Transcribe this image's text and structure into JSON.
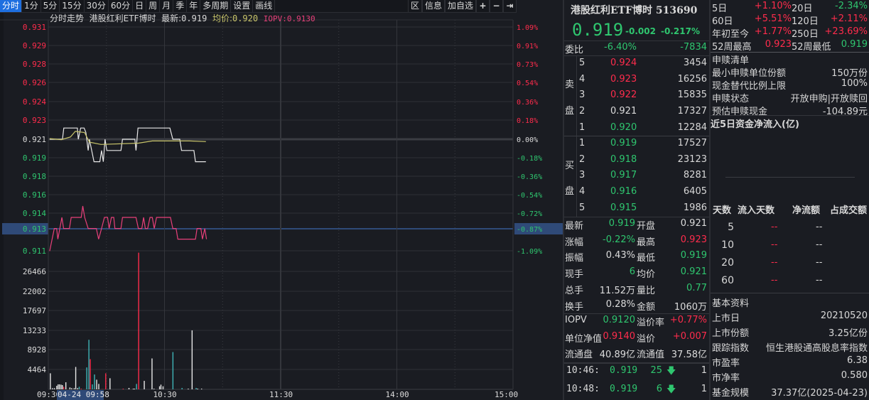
{
  "tabs": [
    "分时",
    "1分",
    "5分",
    "15分",
    "30分",
    "60分",
    "日",
    "周",
    "月",
    "季",
    "年",
    "多周期",
    "设置",
    "画线"
  ],
  "toolbar": {
    "zone": "区",
    "info": "信息",
    "add_watch": "加自选",
    "zoom_in": "+",
    "zoom_out": "−",
    "expand": "⇥"
  },
  "header": {
    "title": "分时走势",
    "name": "港股红利ETF博时",
    "latest_label": "最新:",
    "latest": "0.919",
    "avg_label": "均价:",
    "avg": "0.920",
    "iopv_label": "IOPV:",
    "iopv": "0.9130"
  },
  "chart_data": {
    "type": "line",
    "price_axis": {
      "labels": [
        "0.931",
        "0.929",
        "0.928",
        "0.926",
        "0.924",
        "0.923",
        "0.921",
        "0.919",
        "0.918",
        "0.916",
        "0.914",
        "0.913",
        "0.911"
      ],
      "range": [
        0.911,
        0.931
      ],
      "prev_close": 0.921
    },
    "pct_axis": [
      "1.09%",
      "0.91%",
      "0.73%",
      "0.54%",
      "0.36%",
      "0.18%",
      "0.00%",
      "-0.18%",
      "-0.36%",
      "-0.54%",
      "-0.72%",
      "-0.87%",
      "-1.09%"
    ],
    "highlight_price": "0.913",
    "highlight_pct": "-0.87%",
    "volume_axis": [
      "26466",
      "22002",
      "17697",
      "13233",
      "8928",
      "4464"
    ],
    "volume_max": 30800,
    "time_labels": [
      "09:30",
      "10:30",
      "11:30",
      "14:00",
      "15:00"
    ],
    "cursor_label": "04-24 09:58",
    "minutes_total": 240,
    "series": [
      {
        "name": "price",
        "color": "#e8e8e8",
        "points": [
          [
            0.7,
            0.921
          ],
          [
            7.3,
            0.921
          ],
          [
            8,
            0.922
          ],
          [
            15,
            0.922
          ],
          [
            15.5,
            0.921
          ],
          [
            16.7,
            0.922
          ],
          [
            18.5,
            0.922
          ],
          [
            19.4,
            0.9216
          ],
          [
            20.6,
            0.92
          ],
          [
            21.2,
            0.921
          ],
          [
            23.6,
            0.919
          ],
          [
            26.6,
            0.919
          ],
          [
            27.5,
            0.92
          ],
          [
            28.4,
            0.919
          ],
          [
            29.3,
            0.921
          ],
          [
            30.2,
            0.92
          ],
          [
            37.5,
            0.92
          ],
          [
            38.3,
            0.921
          ],
          [
            44.7,
            0.921
          ],
          [
            45.3,
            0.92
          ],
          [
            46.3,
            0.922
          ],
          [
            62.8,
            0.922
          ],
          [
            64.3,
            0.921
          ],
          [
            67.9,
            0.921
          ],
          [
            68.8,
            0.92
          ],
          [
            75.2,
            0.92
          ],
          [
            76,
            0.919
          ],
          [
            81.4,
            0.919
          ]
        ]
      },
      {
        "name": "average",
        "color": "#c8c46a",
        "points": [
          [
            0.7,
            0.92106
          ],
          [
            6.7,
            0.92096
          ],
          [
            11.5,
            0.92121
          ],
          [
            13.9,
            0.9217
          ],
          [
            18.7,
            0.9216
          ],
          [
            21.2,
            0.92075
          ],
          [
            27.2,
            0.92054
          ],
          [
            46.5,
            0.92065
          ],
          [
            53.7,
            0.92085
          ],
          [
            73,
            0.92085
          ],
          [
            81.4,
            0.92079
          ]
        ]
      },
      {
        "name": "iopv",
        "color": "#e8407a",
        "points": [
          [
            0.7,
            0.91104
          ],
          [
            3.1,
            0.91305
          ],
          [
            4.3,
            0.91305
          ],
          [
            4.9,
            0.9121
          ],
          [
            7,
            0.91404
          ],
          [
            7.9,
            0.91305
          ],
          [
            10.9,
            0.91305
          ],
          [
            11.8,
            0.91404
          ],
          [
            17,
            0.91404
          ],
          [
            17.8,
            0.91505
          ],
          [
            18.8,
            0.91404
          ],
          [
            20.6,
            0.91305
          ],
          [
            24.8,
            0.91305
          ],
          [
            26,
            0.9121
          ],
          [
            27.5,
            0.91305
          ],
          [
            29,
            0.91404
          ],
          [
            30.6,
            0.91404
          ],
          [
            31.4,
            0.91305
          ],
          [
            32.6,
            0.91404
          ],
          [
            33.8,
            0.91404
          ],
          [
            34.4,
            0.91305
          ],
          [
            37.5,
            0.91305
          ],
          [
            38.3,
            0.91404
          ],
          [
            45.3,
            0.91404
          ],
          [
            46.5,
            0.91305
          ],
          [
            48.3,
            0.91305
          ],
          [
            49.2,
            0.91404
          ],
          [
            50.1,
            0.91305
          ],
          [
            51.3,
            0.91305
          ],
          [
            52.5,
            0.91404
          ],
          [
            53.7,
            0.91404
          ],
          [
            54.7,
            0.91305
          ],
          [
            55.9,
            0.91404
          ],
          [
            63.1,
            0.91404
          ],
          [
            64.3,
            0.91305
          ],
          [
            66,
            0.91305
          ],
          [
            66.9,
            0.9121
          ],
          [
            76,
            0.9121
          ],
          [
            76.8,
            0.91305
          ],
          [
            78.8,
            0.91305
          ],
          [
            79.6,
            0.9121
          ],
          [
            80.8,
            0.91305
          ],
          [
            81.7,
            0.9121
          ]
        ]
      }
    ],
    "volume": [
      [
        0.8,
        3604,
        "w"
      ],
      [
        1.9,
        265,
        "w"
      ],
      [
        2.9,
        265,
        "w"
      ],
      [
        4.1,
        795,
        "w"
      ],
      [
        4.8,
        1113,
        "w"
      ],
      [
        5.5,
        1113,
        "w"
      ],
      [
        6.3,
        1060,
        "w"
      ],
      [
        7,
        954,
        "w"
      ],
      [
        7.7,
        583,
        "r"
      ],
      [
        8.8,
        1590,
        "w"
      ],
      [
        10.9,
        424,
        "w"
      ],
      [
        11.8,
        265,
        "w"
      ],
      [
        13.1,
        265,
        "w"
      ],
      [
        13.9,
        5035,
        "w"
      ],
      [
        14.9,
        265,
        "w"
      ],
      [
        15.7,
        583,
        "c"
      ],
      [
        16.7,
        159,
        "r"
      ],
      [
        19.6,
        4929,
        "c"
      ],
      [
        20.7,
        11130,
        "c"
      ],
      [
        21.4,
        6784,
        "r"
      ],
      [
        22.5,
        1113,
        "c"
      ],
      [
        23.6,
        3339,
        "c"
      ],
      [
        24.7,
        2173,
        "w"
      ],
      [
        25.8,
        1219,
        "w"
      ],
      [
        27.6,
        53,
        "r"
      ],
      [
        29.4,
        3604,
        "r"
      ],
      [
        30.5,
        53,
        "c"
      ],
      [
        31.6,
        2491,
        "w"
      ],
      [
        38.4,
        159,
        "r"
      ],
      [
        41.4,
        318,
        "w"
      ],
      [
        43.6,
        159,
        "w"
      ],
      [
        44.3,
        159,
        "w"
      ],
      [
        45.3,
        1219,
        "c"
      ],
      [
        46.4,
        30700,
        "r"
      ],
      [
        49.3,
        1908,
        "w"
      ],
      [
        53.3,
        6943,
        "w"
      ],
      [
        54.3,
        159,
        "w"
      ],
      [
        57.2,
        689,
        "w"
      ],
      [
        57.9,
        1060,
        "w"
      ],
      [
        59,
        689,
        "w"
      ],
      [
        64.1,
        8374,
        "c"
      ],
      [
        68.8,
        318,
        "c"
      ],
      [
        72,
        159,
        "w"
      ],
      [
        74,
        13250,
        "w"
      ],
      [
        76.1,
        318,
        "c"
      ],
      [
        76.9,
        159,
        "w"
      ],
      [
        78.9,
        159,
        "w"
      ]
    ]
  },
  "quote": {
    "name": "港股红利ETF博时",
    "code": "513690",
    "price": "0.919",
    "change": "-0.002",
    "change_pct": "-0.217%",
    "weibi_label": "委比",
    "weibi_pct": "-6.40%",
    "weibi_diff": "-7834",
    "sell_label": [
      "卖",
      "盘"
    ],
    "buy_label": [
      "买",
      "盘"
    ],
    "asks": [
      {
        "lvl": "5",
        "price": "0.924",
        "vol": "3454",
        "c": "r"
      },
      {
        "lvl": "4",
        "price": "0.923",
        "vol": "16256",
        "c": "r"
      },
      {
        "lvl": "3",
        "price": "0.922",
        "vol": "15835",
        "c": "r"
      },
      {
        "lvl": "2",
        "price": "0.921",
        "vol": "17327",
        "c": "w"
      },
      {
        "lvl": "1",
        "price": "0.920",
        "vol": "12284",
        "c": "g"
      }
    ],
    "bids": [
      {
        "lvl": "1",
        "price": "0.919",
        "vol": "17527",
        "c": "g"
      },
      {
        "lvl": "2",
        "price": "0.918",
        "vol": "23123",
        "c": "g"
      },
      {
        "lvl": "3",
        "price": "0.917",
        "vol": "8281",
        "c": "g"
      },
      {
        "lvl": "4",
        "price": "0.916",
        "vol": "6405",
        "c": "g"
      },
      {
        "lvl": "5",
        "price": "0.915",
        "vol": "1986",
        "c": "g"
      }
    ],
    "stats": [
      {
        "l1": "最新",
        "v1": "0.919",
        "c1": "g",
        "l2": "开盘",
        "v2": "0.921",
        "c2": "w"
      },
      {
        "l1": "涨幅",
        "v1": "-0.22%",
        "c1": "g",
        "l2": "最高",
        "v2": "0.923",
        "c2": "r"
      },
      {
        "l1": "振幅",
        "v1": "0.43%",
        "c1": "w",
        "l2": "最低",
        "v2": "0.919",
        "c2": "g"
      },
      {
        "l1": "现手",
        "v1": "6",
        "c1": "g",
        "l2": "均价",
        "v2": "0.921",
        "c2": "g"
      },
      {
        "l1": "总手",
        "v1": "11.52万",
        "c1": "w",
        "l2": "量比",
        "v2": "0.77",
        "c2": "g"
      },
      {
        "l1": "换手",
        "v1": "0.28%",
        "c1": "w",
        "l2": "金额",
        "v2": "1060万",
        "c2": "w"
      }
    ],
    "stats2": [
      {
        "l1": "IOPV",
        "v1": "0.9120",
        "c1": "g",
        "l2": "溢价率",
        "v2": "+0.77%",
        "c2": "r"
      },
      {
        "l1": "单位净值",
        "v1": "0.9140",
        "c1": "r",
        "l2": "溢价",
        "v2": "+0.007",
        "c2": "r"
      },
      {
        "l1": "流通盘",
        "v1": "40.89亿",
        "c1": "w",
        "l2": "流通值",
        "v2": "37.58亿",
        "c2": "w"
      }
    ],
    "ticks": [
      {
        "time": "10:46:",
        "price": "0.919",
        "vol": "25",
        "n": "1"
      },
      {
        "time": "10:48:",
        "price": "0.919",
        "vol": "6",
        "n": "1"
      }
    ]
  },
  "perf": [
    {
      "l1": "5日",
      "v1": "+1.10%",
      "c1": "r",
      "l2": "20日",
      "v2": "-2.34%",
      "c2": "g"
    },
    {
      "l1": "60日",
      "v1": "+5.51%",
      "c1": "r",
      "l2": "120日",
      "v2": "+2.11%",
      "c2": "r"
    },
    {
      "l1": "年初至今",
      "v1": "+1.77%",
      "c1": "r",
      "l2": "250日",
      "v2": "+23.69%",
      "c2": "r"
    },
    {
      "l1": "52周最高",
      "v1": "0.923",
      "c1": "r",
      "l2": "52周最低",
      "v2": "0.919",
      "c2": "g"
    }
  ],
  "redeem": {
    "title": "申赎清单",
    "rows": [
      {
        "k": "最小申赎单位份额",
        "v": "150万份"
      },
      {
        "k": "现金替代比例上限",
        "v": "100%"
      },
      {
        "k": "申赎状态",
        "v": "开放申购|开放赎回"
      },
      {
        "k": "预估申赎现金",
        "v": "-104.89元"
      }
    ]
  },
  "flow": {
    "title": "近5日资金净流入(亿)",
    "headers": [
      "天数",
      "流入天数",
      "净流额",
      "占成交额"
    ],
    "rows": [
      {
        "d": "5",
        "a": "--",
        "b": "--"
      },
      {
        "d": "10",
        "a": "--",
        "b": "--"
      },
      {
        "d": "20",
        "a": "--",
        "b": "--"
      },
      {
        "d": "60",
        "a": "--",
        "b": "--"
      }
    ]
  },
  "basic": {
    "title": "基本资料",
    "rows": [
      {
        "k": "上市日",
        "v": "20210520"
      },
      {
        "k": "上市份额",
        "v": "3.25亿份"
      },
      {
        "k": "跟踪指数",
        "v": "恒生港股通高股息率指数"
      },
      {
        "k": "市盈率",
        "v": "6.38"
      },
      {
        "k": "市净率",
        "v": "0.580"
      },
      {
        "k": "基金规模",
        "v": "37.37亿(2025-04-23)"
      }
    ]
  }
}
